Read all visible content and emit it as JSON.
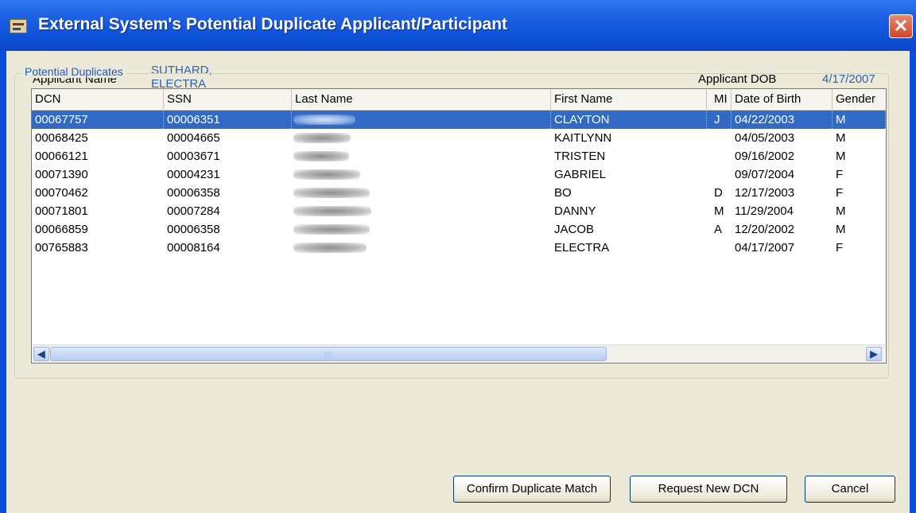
{
  "window": {
    "title": "External System's Potential Duplicate Applicant/Participant",
    "close_glyph": "✕"
  },
  "applicant": {
    "name_label": "Applicant Name",
    "name_last": "SUTHARD,",
    "name_first": "ELECTRA",
    "dob_label": "Applicant DOB",
    "dob": "4/17/2007"
  },
  "group": {
    "title": "Potential Duplicates"
  },
  "table": {
    "columns": [
      "DCN",
      "SSN",
      "Last Name",
      "First Name",
      "MI",
      "Date of Birth",
      "Gender"
    ],
    "selected_row": 0,
    "rows": [
      {
        "dcn": "00067757",
        "ssn": "00006351",
        "last": "",
        "first": "CLAYTON",
        "mi": "J",
        "dob": "04/22/2003",
        "gender": "M"
      },
      {
        "dcn": "00068425",
        "ssn": "00004665",
        "last": "",
        "first": "KAITLYNN",
        "mi": "",
        "dob": "04/05/2003",
        "gender": "M"
      },
      {
        "dcn": "00066121",
        "ssn": "00003671",
        "last": "",
        "first": "TRISTEN",
        "mi": "",
        "dob": "09/16/2002",
        "gender": "M"
      },
      {
        "dcn": "00071390",
        "ssn": "00004231",
        "last": "",
        "first": "GABRIEL",
        "mi": "",
        "dob": "09/07/2004",
        "gender": "F"
      },
      {
        "dcn": "00070462",
        "ssn": "00006358",
        "last": "",
        "first": "BO",
        "mi": "D",
        "dob": "12/17/2003",
        "gender": "F"
      },
      {
        "dcn": "00071801",
        "ssn": "00007284",
        "last": "",
        "first": "DANNY",
        "mi": "M",
        "dob": "11/29/2004",
        "gender": "M"
      },
      {
        "dcn": "00066859",
        "ssn": "00006358",
        "last": "",
        "first": "JACOB",
        "mi": "A",
        "dob": "12/20/2002",
        "gender": "M"
      },
      {
        "dcn": "00765883",
        "ssn": "00008164",
        "last": "",
        "first": "ELECTRA",
        "mi": "",
        "dob": "04/17/2007",
        "gender": "F"
      }
    ]
  },
  "scrollbar": {
    "left_glyph": "◀",
    "right_glyph": "▶",
    "thumb_grip": "|||"
  },
  "buttons": {
    "confirm": "Confirm Duplicate Match",
    "request": "Request New DCN",
    "cancel": "Cancel"
  },
  "colors": {
    "title_bar": "#0a4fd8",
    "selection": "#316ac5",
    "value_text": "#2c62b0",
    "dialog_face": "#ece9d8"
  }
}
